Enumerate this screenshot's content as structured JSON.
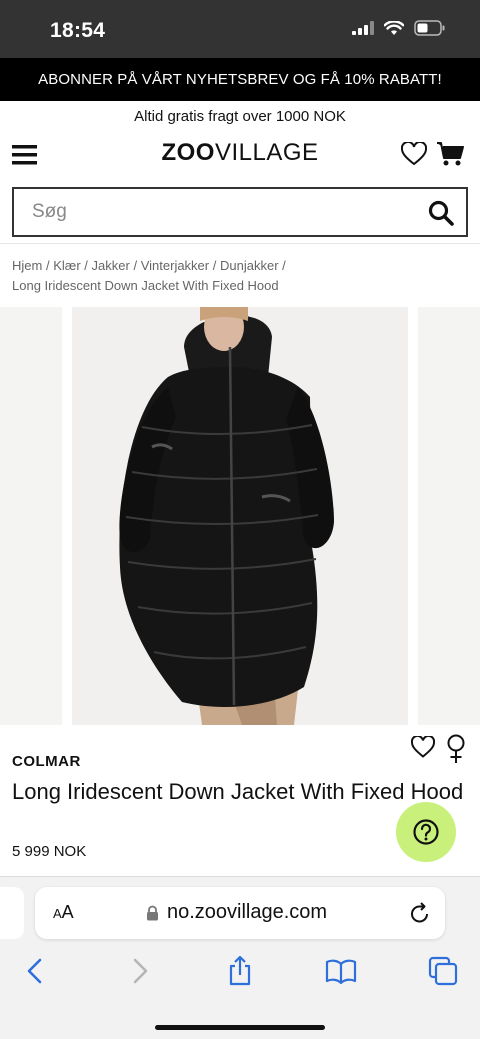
{
  "status": {
    "time": "18:54"
  },
  "promo": {
    "text": "ABONNER PÅ VÅRT NYHETSBREV OG FÅ 10% RABATT!"
  },
  "shipping": {
    "text": "Altid gratis fragt over 1000 NOK"
  },
  "header": {
    "logo_bold": "ZOO",
    "logo_regular": "VILLAGE"
  },
  "search": {
    "placeholder": "Søg"
  },
  "breadcrumb": {
    "items": [
      "Hjem",
      "Klær",
      "Jakker",
      "Vinterjakker",
      "Dunjakker"
    ],
    "separator": "/",
    "current": "Long Iridescent Down Jacket With Fixed Hood"
  },
  "product": {
    "brand": "COLMAR",
    "title": "Long Iridescent Down Jacket With Fixed Hood",
    "price": "5 999 NOK"
  },
  "browser": {
    "aa_label_small": "A",
    "aa_label_large": "A",
    "url": "no.zoovillage.com"
  },
  "colors": {
    "promo_bg": "#000000",
    "help_bg": "#c8f07a",
    "status_bg": "#333333"
  },
  "icons": [
    "menu-icon",
    "heart-icon",
    "cart-icon",
    "search-icon",
    "female-icon",
    "help-icon",
    "lock-icon",
    "reload-icon",
    "back-icon",
    "forward-icon",
    "share-icon",
    "bookmarks-icon",
    "tabs-icon"
  ]
}
